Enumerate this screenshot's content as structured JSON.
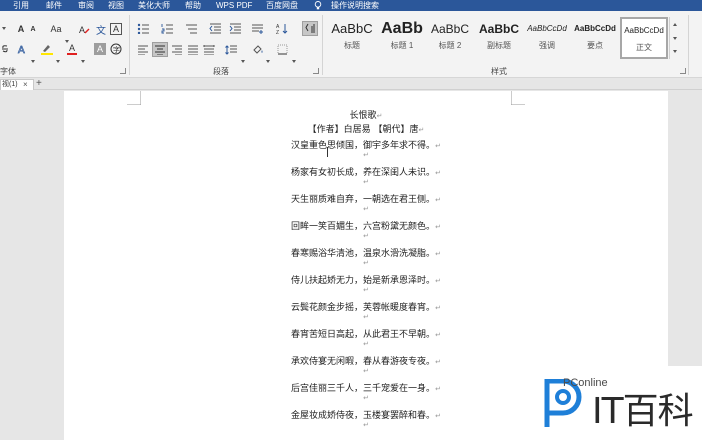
{
  "menu": {
    "items": [
      "引用",
      "邮件",
      "审阅",
      "视图",
      "美化大师",
      "帮助",
      "WPS PDF",
      "百度网盘"
    ],
    "search_hint": "操作说明搜索"
  },
  "ribbon": {
    "font_group_label": "字体",
    "paragraph_group_label": "段落",
    "styles_group_label": "样式",
    "font_case_label": "Aa",
    "font_color_letter": "A",
    "text_effect_letter": "A",
    "char_border_letter": "A",
    "accent_red": "#e02020",
    "highlight_yellow": "#ffe600"
  },
  "styles": [
    {
      "preview": "AaBbC",
      "name": "标题"
    },
    {
      "preview": "AaBb",
      "name": "标题 1"
    },
    {
      "preview": "AaBbC",
      "name": "标题 2"
    },
    {
      "preview": "AaBbC",
      "name": "副标题"
    },
    {
      "preview": "AaBbCcDd",
      "name": "强调"
    },
    {
      "preview": "AaBbCcDd",
      "name": "要点"
    },
    {
      "preview": "AaBbCcDd",
      "name": "正文"
    }
  ],
  "tabs": {
    "doc_tab_label": "视(1)",
    "close_glyph": "×",
    "add_glyph": "+"
  },
  "document": {
    "title": "长恨歌",
    "author_line": "【作者】白居易 【朝代】唐",
    "lines": [
      "汉皇重色思倾国，御宇多年求不得。",
      "杨家有女初长成，养在深闺人未识。",
      "天生丽质难自弃，一朝选在君王侧。",
      "回眸一笑百媚生，六宫粉黛无颜色。",
      "春寒赐浴华清池，温泉水滑洗凝脂。",
      "侍儿扶起娇无力，始是新承恩泽时。",
      "云鬓花颜金步摇，芙蓉帐暖度春宵。",
      "春宵苦短日高起，从此君王不早朝。",
      "承欢侍宴无闲暇，春从春游夜专夜。",
      "后宫佳丽三千人，三千宠爱在一身。",
      "金屋妆成娇侍夜，玉楼宴罢醉和春。"
    ],
    "return_mark": "↵"
  },
  "watermark": {
    "brand": "PConline",
    "big_text": "IT百科",
    "accent_blue": "#1e7fd8"
  }
}
